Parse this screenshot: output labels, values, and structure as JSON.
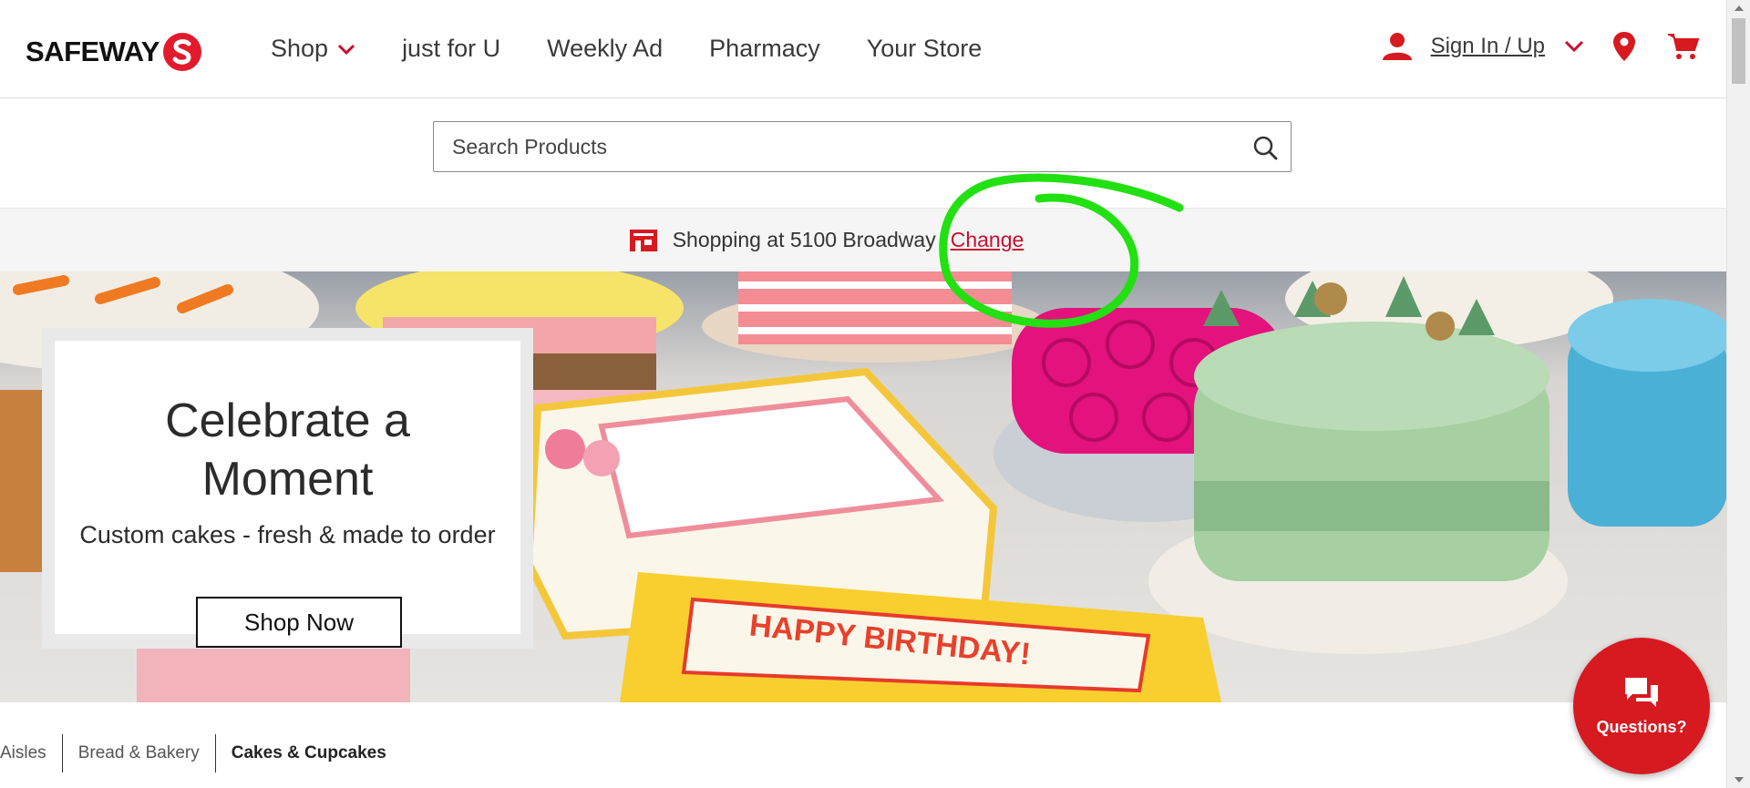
{
  "header": {
    "logo_text": "SAFEWAY",
    "nav": [
      {
        "label": "Shop"
      },
      {
        "label": "just for U"
      },
      {
        "label": "Weekly Ad"
      },
      {
        "label": "Pharmacy"
      },
      {
        "label": "Your Store"
      }
    ],
    "sign_in_label": "Sign In / Up"
  },
  "search": {
    "placeholder": "Search Products"
  },
  "store_bar": {
    "text": "Shopping at 5100 Broadway",
    "change_label": "Change"
  },
  "hero": {
    "title_line1": "Celebrate a",
    "title_line2": "Moment",
    "subtitle": "Custom cakes - fresh & made to order",
    "cta_label": "Shop Now",
    "cake_banner_text": "HAPPY BIRTHDAY!"
  },
  "breadcrumb": [
    "Aisles",
    "Bread & Bakery",
    "Cakes & Cupcakes"
  ],
  "questions_label": "Questions?",
  "colors": {
    "brand_red": "#e21a2c",
    "annotation_green": "#22e011",
    "link_red": "#c8102e"
  },
  "icons": [
    "chevron-down-icon",
    "user-icon",
    "location-pin-icon",
    "cart-icon",
    "search-icon",
    "store-icon",
    "chat-icon"
  ]
}
